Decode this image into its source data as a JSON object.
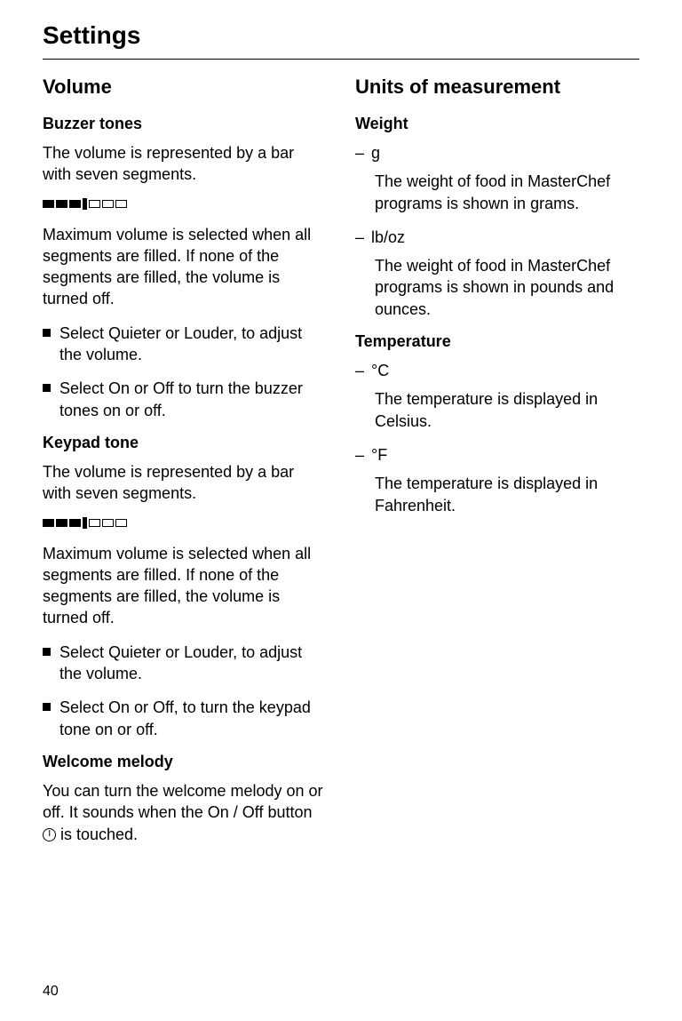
{
  "pageTitle": "Settings",
  "pageNumber": "40",
  "left": {
    "heading": "Volume",
    "buzzer": {
      "heading": "Buzzer tones",
      "intro": "The volume is represented by a bar with seven segments.",
      "desc": "Maximum volume is selected when all segments are filled. If none of the segments are filled, the volume is turned off.",
      "b1_pre": "Select ",
      "b1_opt1": "Quieter",
      "b1_mid": " or ",
      "b1_opt2": "Louder",
      "b1_post": ", to adjust the volume.",
      "b2_pre": "Select ",
      "b2_opt1": "On",
      "b2_mid": " or ",
      "b2_opt2": "Off",
      "b2_post": " to turn the buzzer tones on or off."
    },
    "keypad": {
      "heading": "Keypad tone",
      "intro": "The volume is represented by a bar with seven segments.",
      "desc": "Maximum volume is selected when all segments are filled. If none of the segments are filled, the volume is turned off.",
      "b1_pre": "Select ",
      "b1_opt1": "Quieter",
      "b1_mid": " or ",
      "b1_opt2": "Louder",
      "b1_post": ", to adjust the volume.",
      "b2_pre": "Select ",
      "b2_opt1": "On",
      "b2_mid": " or ",
      "b2_opt2": "Off",
      "b2_post": ", to turn the keypad tone on or off."
    },
    "welcome": {
      "heading": "Welcome melody",
      "desc_pre": "You can turn the welcome melody on or off. It sounds when the On / Off button ",
      "desc_post": " is touched."
    }
  },
  "right": {
    "heading": "Units of measurement",
    "weight": {
      "heading": "Weight",
      "g_label": "g",
      "g_desc": "The weight of food in MasterChef programs is shown in grams.",
      "lb_label": "lb/oz",
      "lb_desc": "The weight of food in MasterChef programs is shown in pounds and ounces."
    },
    "temp": {
      "heading": "Temperature",
      "c_label": "°C",
      "c_desc": "The temperature is displayed in Celsius.",
      "f_label": "°F",
      "f_desc": "The temperature is displayed in Fahrenheit."
    }
  }
}
